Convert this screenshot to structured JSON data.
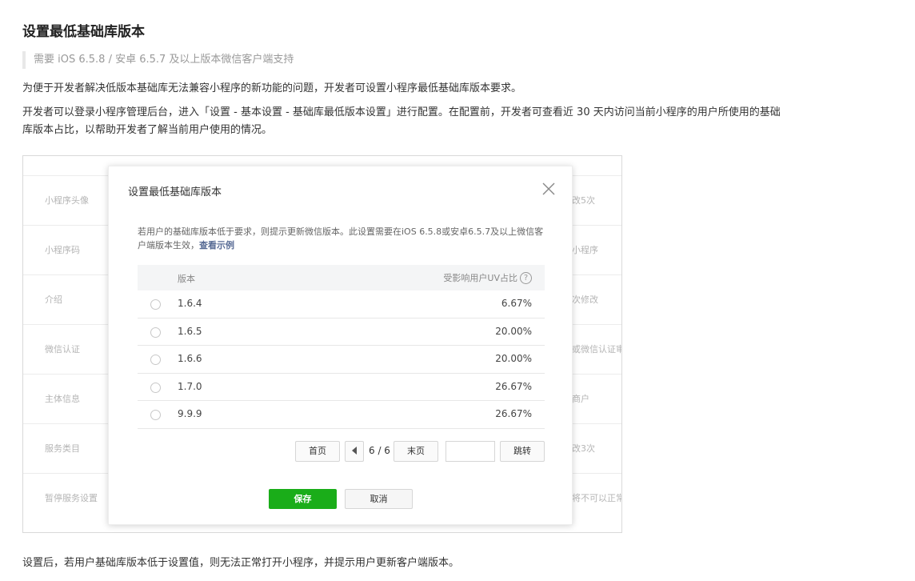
{
  "page": {
    "title": "设置最低基础库版本",
    "tip": "需要 iOS 6.5.8 / 安卓 6.5.7 及以上版本微信客户端支持",
    "para1": "为便于开发者解决低版本基础库无法兼容小程序的新功能的问题，开发者可设置小程序最低基础库版本要求。",
    "para2": "开发者可以登录小程序管理后台，进入「设置 - 基本设置 - 基础库最低版本设置」进行配置。在配置前，开发者可查看近 30 天内访问当前小程序的用户所使用的基础库版本占比，以帮助开发者了解当前用户使用的情况。",
    "para3": "设置后，若用户基础库版本低于设置值，则无法正常打开小程序，并提示用户更新客户端版本。"
  },
  "background": {
    "rows": [
      {
        "label": "小程序头像",
        "right": "改5次"
      },
      {
        "label": "小程序码",
        "right": "小程序"
      },
      {
        "label": "介绍",
        "right": "次修改"
      },
      {
        "label": "微信认证",
        "right": "或微信认证审"
      },
      {
        "label": "主体信息",
        "right": "商户"
      },
      {
        "label": "服务类目",
        "right": "改3次"
      },
      {
        "label": "暂停服务设置",
        "right": "将不可以正常"
      }
    ]
  },
  "dialog": {
    "title": "设置最低基础库版本",
    "desc": "若用户的基础库版本低于要求，则提示更新微信版本。此设置需要在iOS 6.5.8或安卓6.5.7及以上微信客户端版本生效，",
    "desc_link": "查看示例",
    "table": {
      "col_version": "版本",
      "col_uv": "受影响用户UV占比",
      "help": "?",
      "rows": [
        {
          "version": "1.6.4",
          "uv": "6.67%"
        },
        {
          "version": "1.6.5",
          "uv": "20.00%"
        },
        {
          "version": "1.6.6",
          "uv": "20.00%"
        },
        {
          "version": "1.7.0",
          "uv": "26.67%"
        },
        {
          "version": "9.9.9",
          "uv": "26.67%"
        }
      ]
    },
    "pager": {
      "first": "首页",
      "page": "6 / 6",
      "last": "末页",
      "jump": "跳转",
      "input_value": ""
    },
    "save": "保存",
    "cancel": "取消"
  }
}
